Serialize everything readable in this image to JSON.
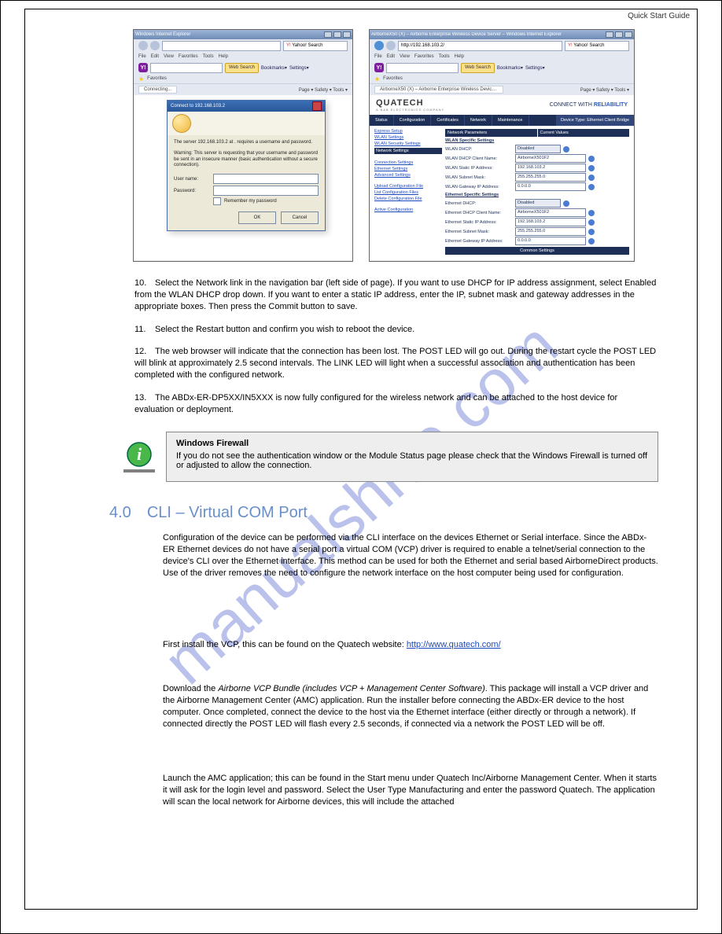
{
  "header_right": "Quick Start Guide",
  "watermark": "manualshive.com",
  "ie": {
    "title1": "Windows Internet Explorer",
    "title2": "AirborneX50 (X) – Airborne Enterprise Wireless Device Server – Windows Internet Explorer",
    "menu": [
      "File",
      "Edit",
      "View",
      "Favorites",
      "Tools",
      "Help"
    ],
    "favorites_word": "Favorites",
    "tools_row": "Page ▾  Safety ▾  Tools ▾",
    "connecting_tab": "Connecting...",
    "device_tab": "AirborneX50 (X) – Airborne Enterprise Wireless Device ...",
    "url1": "",
    "url2": "http://192.168.103.2/",
    "yahoo_placeholder": "Yahoo! Search",
    "yahoo_btn": "Web Search",
    "bookmarks": "Bookmarks▾",
    "settings": "Settings▾"
  },
  "dlg": {
    "title": "Connect to 192.168.103.2",
    "line1": "The server 192.168.103.2 at . requires a username and password.",
    "line2": "Warning: This server is requesting that your username and password be sent in an insecure manner (basic authentication without a secure connection).",
    "user_label": "User name:",
    "pass_label": "Password:",
    "remember": "Remember my password",
    "ok": "OK",
    "cancel": "Cancel"
  },
  "quatech": {
    "brand": "QUATECH",
    "brand_sub": "A B&B ELECTRONICS COMPANY",
    "tag_a": "CONNECT WITH ",
    "tag_b": "RELIABILITY",
    "nav": [
      "Status",
      "Configuration",
      "Certificates",
      "Network",
      "Maintenance"
    ],
    "dev_type": "Device Type: Ethernet Client Bridge",
    "side_links": [
      "Express Setup",
      "WLAN Settings",
      "WLAN Security Settings",
      "Network Settings",
      "",
      "Connection Settings",
      "Ethernet Settings",
      "Advanced Settings",
      "",
      "Upload Configuration File",
      "List Configuration Files",
      "Delete Configuration File",
      "",
      "Active Configuration"
    ],
    "params_hdr": "Network Parameters",
    "values_hdr": "Current Values",
    "group1": "WLAN Specific Settings",
    "group2": "Ethernet Specific Settings",
    "rows": [
      {
        "lab": "WLAN DHCP:",
        "fld": "Disabled",
        "type": "sel"
      },
      {
        "lab": "WLAN DHCP Client Name:",
        "fld": "AirborneX501F2",
        "type": "inp"
      },
      {
        "lab": "WLAN Static IP Address:",
        "fld": "192.168.103.2",
        "type": "inp"
      },
      {
        "lab": "WLAN Subnet Mask:",
        "fld": "255.255.255.0",
        "type": "inp"
      },
      {
        "lab": "WLAN Gateway IP Address:",
        "fld": "0.0.0.0",
        "type": "inp"
      }
    ],
    "rows2": [
      {
        "lab": "Ethernet DHCP:",
        "fld": "Disabled",
        "type": "sel"
      },
      {
        "lab": "Ethernet DHCP Client Name:",
        "fld": "AirborneX501F2",
        "type": "inp"
      },
      {
        "lab": "Ethernet Static IP Address:",
        "fld": "192.168.103.2",
        "type": "inp"
      },
      {
        "lab": "Ethernet Subnet Mask:",
        "fld": "255.255.255.0",
        "type": "inp"
      },
      {
        "lab": "Ethernet Gateway IP Address:",
        "fld": "0.0.0.0",
        "type": "inp"
      }
    ],
    "common_bar": "Common Settings"
  },
  "step10": {
    "n": "10.",
    "text": "Select the Network link in the navigation bar (left side of page). If you want to use DHCP for IP address assignment, select Enabled from the WLAN DHCP drop down. If you want to enter a static IP address, enter the IP, subnet mask and gateway addresses in the appropriate boxes. Then press the Commit button to save."
  },
  "step11": {
    "n": "11.",
    "text": "Select the Restart button and confirm you wish to reboot the device."
  },
  "step12": {
    "n": "12.",
    "text": "The web browser will indicate that the connection has been lost. The POST LED will go out. During the restart cycle the POST LED will blink at approximately 2.5 second intervals. The LINK LED will light when a successful association and authentication has been completed with the configured network."
  },
  "step13": {
    "n": "13.",
    "text": "The ABDx-ER-DP5XX/IN5XXX is now fully configured for the wireless network and can be attached to the host device for evaluation or deployment."
  },
  "callout_head": "Windows Firewall",
  "callout_body": "If you do not see the authentication window or the Module Status page please check that the Windows Firewall is turned off or adjusted to allow the connection.",
  "section_num": "4.0",
  "section_title": "CLI – Virtual COM Port",
  "cli_p1": "Configuration of the device can be performed via the CLI interface on the devices Ethernet or Serial interface. Since the ABDx-ER Ethernet devices do not have a serial port a virtual COM (VCP) driver is required to enable a telnet/serial connection to the device's CLI over the Ethernet interface. This method can be used for both the Ethernet and serial based AirborneDirect products. Use of the driver removes the need to configure the network interface on the host computer being used for configuration.",
  "cli_p2": "First install the VCP, this can be found on the Quatech website: ",
  "cli_link": "http://www.quatech.com/",
  "cli_p3a": "Download the ",
  "cli_p3b": "Airborne VCP Bundle (includes VCP + Management Center Software)",
  "cli_p3c": ". This package will install a VCP driver and the Airborne Management Center (AMC) application. Run the installer before connecting the ABDx-ER device to the host computer. Once completed, connect the device to the host via the Ethernet interface (either directly or through a network). If connected directly the POST LED will flash every 2.5 seconds, if connected via a network the POST LED will be off.",
  "cli_p4": "Launch the AMC application; this can be found in the Start menu under Quatech Inc/Airborne Management Center. When it starts it will ask for the login level and password. Select the User Type Manufacturing and enter the password Quatech. The application will scan the local network for Airborne devices, this will include the attached"
}
